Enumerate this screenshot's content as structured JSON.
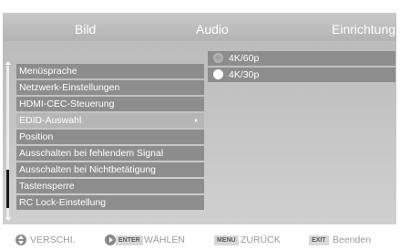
{
  "tabs": {
    "bild": "Bild",
    "audio": "Audio",
    "einrichtung": "Einrichtung"
  },
  "menu": {
    "items": [
      "Menüsprache",
      "Netzwerk-Einstellungen",
      "HDMI-CEC-Steuerung",
      "EDID-Auswahl",
      "Position",
      "Ausschalten bei fehlendem Signal",
      "Ausschalten bei Nichtbetätigung",
      "Tastensperre",
      "RC Lock-Einstellung"
    ],
    "selected_index": 3
  },
  "options": {
    "items": [
      "4K/60p",
      "4K/30p"
    ],
    "checked_index": 1
  },
  "hints": {
    "move": "VERSCHI.",
    "enter_key": "ENTER",
    "select": "WÄHLEN",
    "menu_key": "MENU",
    "back": "ZURÜCK",
    "exit_key": "EXIT",
    "quit": "Beenden"
  },
  "colors": {
    "menu_item_bg": "#8d8d8d",
    "menu_item_selected_bg": "#b6b6b6",
    "hint_text": "#9a9a9a"
  }
}
